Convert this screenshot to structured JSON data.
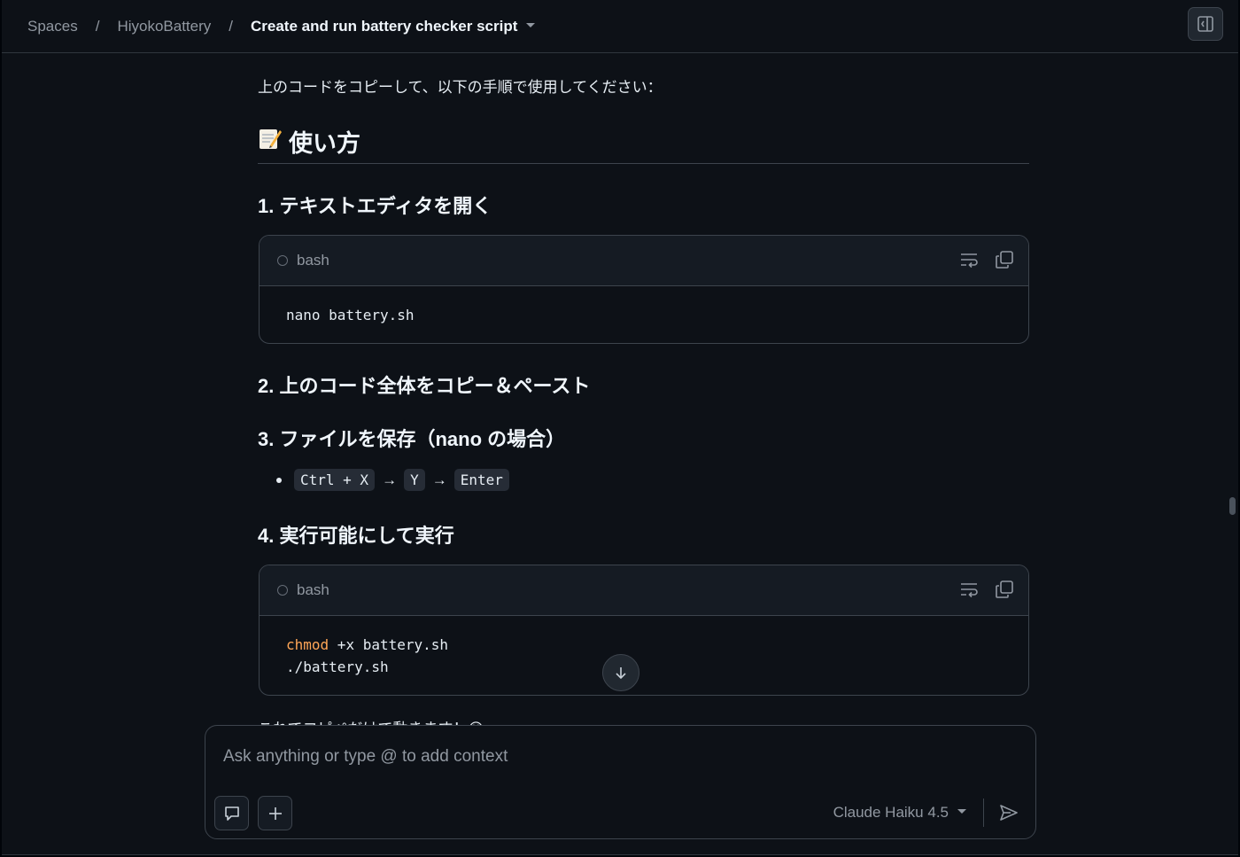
{
  "header": {
    "breadcrumb": [
      "Spaces",
      "HiyokoBattery"
    ],
    "separator": "/",
    "current": "Create and run battery checker script"
  },
  "content": {
    "intro": "上のコードをコピーして、以下の手順で使用してください：",
    "heading": "使い方",
    "step1": "1. テキストエディタを開く",
    "code1": {
      "lang": "bash",
      "line1": "nano battery.sh"
    },
    "step2": "2. 上のコード全体をコピー＆ペースト",
    "step3": "3. ファイルを保存（nano の場合）",
    "keys": {
      "k1": "Ctrl + X",
      "arrow": "→",
      "k2": "Y",
      "k3": "Enter"
    },
    "step4": "4. 実行可能にして実行",
    "code2": {
      "lang": "bash",
      "cmd": "chmod",
      "args": " +x battery.sh",
      "line2": "./battery.sh"
    },
    "tail": "これでコピペだけで動きます！😊"
  },
  "composer": {
    "placeholder": "Ask anything or type @ to add context",
    "model": "Claude Haiku 4.5"
  }
}
